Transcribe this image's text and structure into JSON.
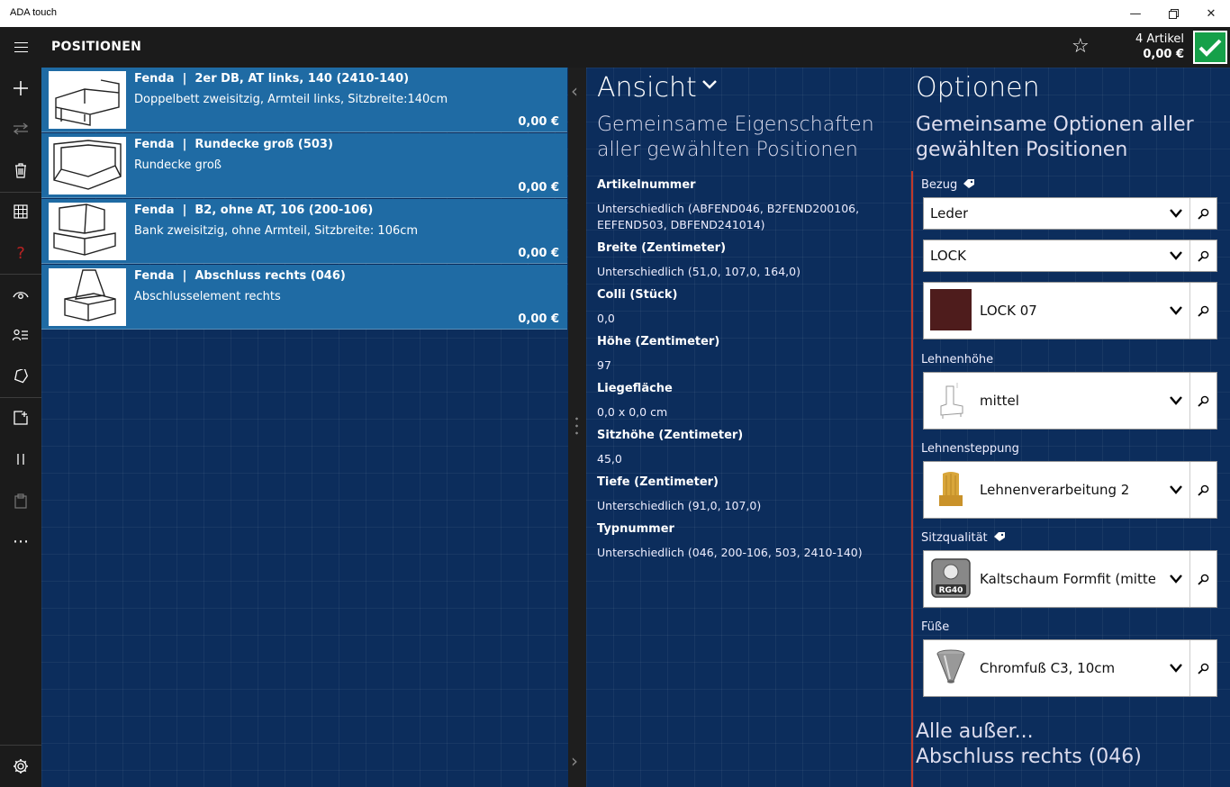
{
  "window": {
    "title": "ADA touch"
  },
  "header": {
    "title": "POSITIONEN",
    "cart_count": "4 Artikel",
    "cart_total": "0,00 €"
  },
  "positions": [
    {
      "brand": "Fenda",
      "code": "2er DB, AT links, 140 (2410-140)",
      "desc": "Doppelbett zweisitzig, Armteil links, Sitzbreite:140cm",
      "price": "0,00 €"
    },
    {
      "brand": "Fenda",
      "code": "Rundecke groß (503)",
      "desc": "Rundecke groß",
      "price": "0,00 €"
    },
    {
      "brand": "Fenda",
      "code": "B2, ohne AT, 106 (200-106)",
      "desc": "Bank zweisitzig, ohne Armteil, Sitzbreite: 106cm",
      "price": "0,00 €"
    },
    {
      "brand": "Fenda",
      "code": "Abschluss rechts (046)",
      "desc": "Abschlusselement rechts",
      "price": "0,00 €"
    }
  ],
  "ansicht": {
    "title": "Ansicht",
    "subtitle": "Gemeinsame Eigenschaften aller gewählten Positionen",
    "properties": [
      {
        "name": "Artikelnummer",
        "value": "Unterschiedlich (ABFEND046, B2FEND200106, EEFEND503, DBFEND241014)"
      },
      {
        "name": "Breite (Zentimeter)",
        "value": "Unterschiedlich (51,0, 107,0, 164,0)"
      },
      {
        "name": "Colli (Stück)",
        "value": "0,0"
      },
      {
        "name": "Höhe (Zentimeter)",
        "value": "97"
      },
      {
        "name": "Liegefläche",
        "value": "0,0 x 0,0 cm"
      },
      {
        "name": "Sitzhöhe (Zentimeter)",
        "value": "45,0"
      },
      {
        "name": "Tiefe (Zentimeter)",
        "value": "Unterschiedlich (91,0, 107,0)"
      },
      {
        "name": "Typnummer",
        "value": "Unterschiedlich (046, 200-106, 503, 2410-140)"
      }
    ]
  },
  "optionen": {
    "title": "Optionen",
    "subtitle": "Gemeinsame Optionen aller gewählten Positionen",
    "bezug_label": "Bezug",
    "bezug_material": "Leder",
    "bezug_collection": "LOCK",
    "bezug_color": "LOCK 07",
    "bezug_color_hex": "#4e1c1c",
    "lehnenhoehe_label": "Lehnenhöhe",
    "lehnenhoehe_value": "mittel",
    "lehnensteppung_label": "Lehnensteppung",
    "lehnensteppung_value": "Lehnenverarbeitung 2",
    "sitzqualitaet_label": "Sitzqualität",
    "sitzqualitaet_value": "Kaltschaum Formfit (mittelf",
    "sitzqualitaet_badge": "RG40",
    "fuesse_label": "Füße",
    "fuesse_value": "Chromfuß C3, 10cm",
    "alle_line1": "Alle außer...",
    "alle_line2": "Abschluss rechts (046)"
  },
  "accent_colors": {
    "list_item": "#1f6ba4",
    "confirm": "#15a049",
    "divider": "#c0392b"
  }
}
